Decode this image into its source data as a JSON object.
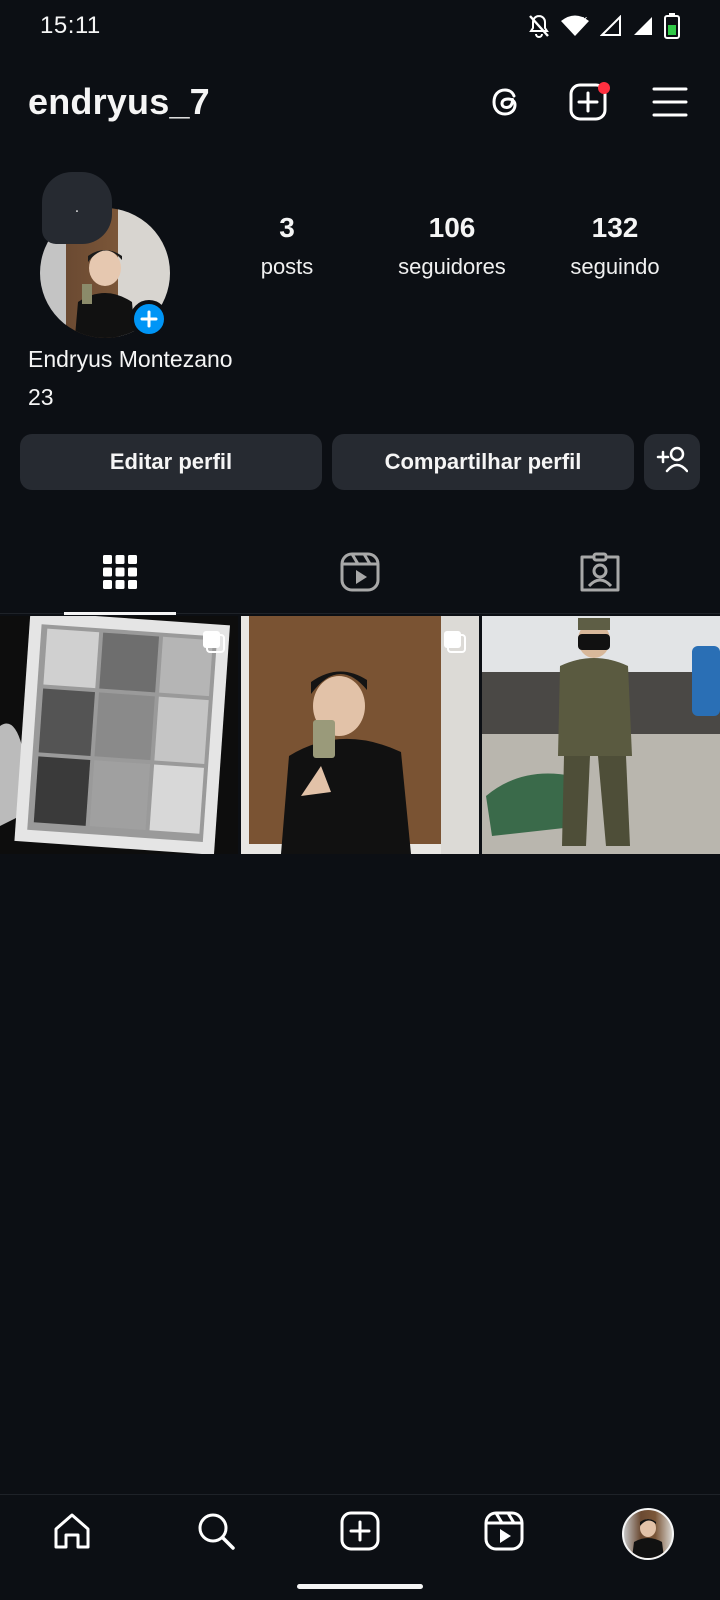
{
  "status_bar": {
    "time": "15:11",
    "icons": [
      "bell-muted-icon",
      "wifi-icon",
      "signal-icon",
      "signal-icon",
      "battery-icon"
    ]
  },
  "header": {
    "username": "endryus_7",
    "icons": [
      "threads-icon",
      "create-icon",
      "menu-icon"
    ]
  },
  "profile": {
    "note": ".",
    "full_name": "Endryus Montezano",
    "bio": "23",
    "stats": [
      {
        "value": "3",
        "label": "posts"
      },
      {
        "value": "106",
        "label": "seguidores"
      },
      {
        "value": "132",
        "label": "seguindo"
      }
    ]
  },
  "actions": {
    "edit_label": "Editar perfil",
    "share_label": "Compartilhar perfil"
  },
  "tabs": [
    "grid-icon",
    "reels-icon",
    "tagged-icon"
  ],
  "posts": [
    {
      "description": "black and white photo collage",
      "multi": true
    },
    {
      "description": "mirror selfie",
      "multi": true
    },
    {
      "description": "man in camouflage uniform",
      "multi": false
    }
  ],
  "bottom_nav": [
    "home-icon",
    "search-icon",
    "create-icon",
    "reels-icon",
    "profile-avatar"
  ],
  "colors": {
    "background": "#0c0f14",
    "button": "#262a31",
    "accent": "#0095f6",
    "notification": "#ff3040"
  }
}
